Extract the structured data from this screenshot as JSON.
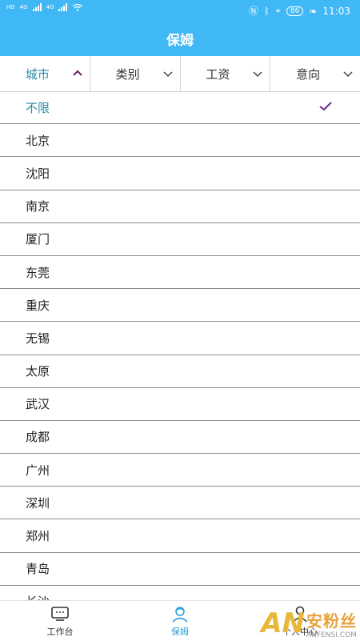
{
  "status_bar": {
    "left_labels": [
      "HD",
      "4G",
      "4G"
    ],
    "battery": "86",
    "time": "11:03"
  },
  "header": {
    "title": "保姆"
  },
  "filters": [
    {
      "label": "城市",
      "active": true
    },
    {
      "label": "类别",
      "active": false
    },
    {
      "label": "工资",
      "active": false
    },
    {
      "label": "意向",
      "active": false
    }
  ],
  "cities": [
    "不限",
    "北京",
    "沈阳",
    "南京",
    "厦门",
    "东莞",
    "重庆",
    "无锡",
    "太原",
    "武汉",
    "成都",
    "广州",
    "深圳",
    "郑州",
    "青岛",
    "长沙"
  ],
  "selected_city": "不限",
  "bottom_nav": [
    {
      "label": "工作台",
      "icon": "workbench-icon"
    },
    {
      "label": "保姆",
      "icon": "nanny-icon",
      "active": true
    },
    {
      "label": "个人中心",
      "icon": "profile-icon"
    }
  ],
  "watermark": {
    "logo": "AN",
    "main": "安粉丝",
    "sub": "ANFENSI.COM"
  },
  "colors": {
    "primary": "#3fb8f5",
    "active_text": "#2a8aa6",
    "check": "#6a2a8a"
  }
}
